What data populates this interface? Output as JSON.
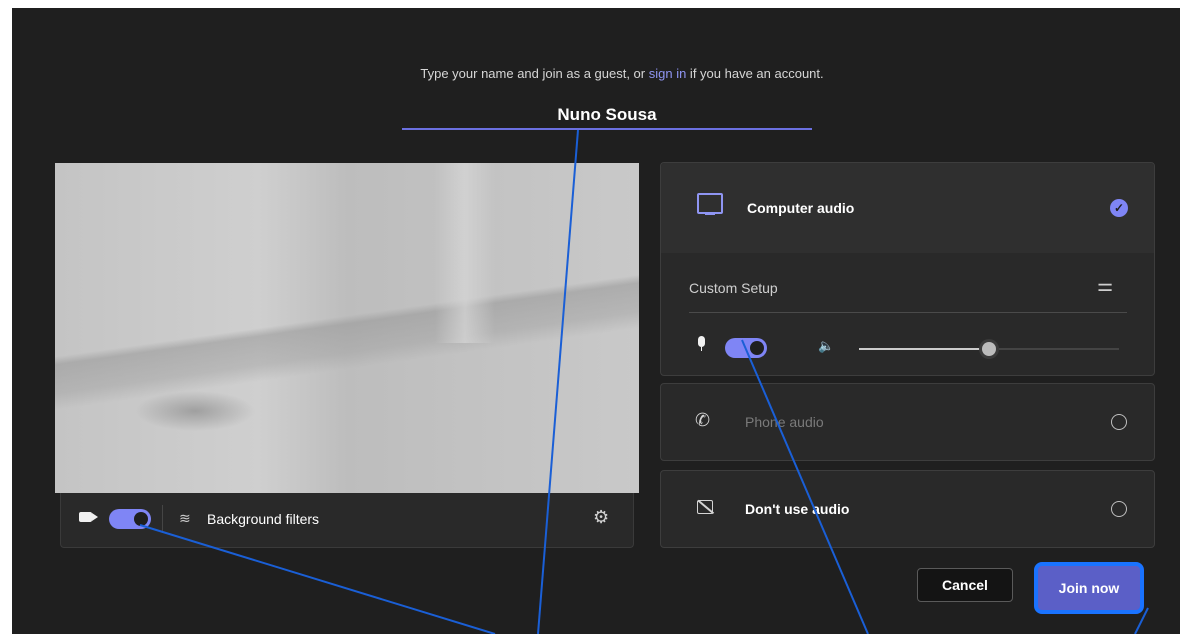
{
  "prompt": {
    "before": "Type your name and join as a guest, or ",
    "link": "sign in",
    "after": " if you have an account."
  },
  "name_input": {
    "value": "Nuno Sousa"
  },
  "video_controls": {
    "camera_on": true,
    "background_filters_label": "Background filters",
    "icons": [
      "camera-icon",
      "background-filters-icon",
      "settings-gear-icon"
    ]
  },
  "audio": {
    "computer_audio": {
      "label": "Computer audio",
      "selected": true
    },
    "custom_setup": {
      "label": "Custom Setup",
      "mic_on": true,
      "volume_level": 0.5
    },
    "phone_audio": {
      "label": "Phone audio",
      "selected": false
    },
    "no_audio": {
      "label": "Don't use audio",
      "selected": false
    }
  },
  "actions": {
    "cancel_label": "Cancel",
    "join_label": "Join now"
  },
  "colors": {
    "background": "#1f1f1f",
    "accent": "#7f85f5",
    "primary_button": "#5b5fc7",
    "highlight_outline": "#1a73ff",
    "annotation_line": "#1a5fd6"
  }
}
